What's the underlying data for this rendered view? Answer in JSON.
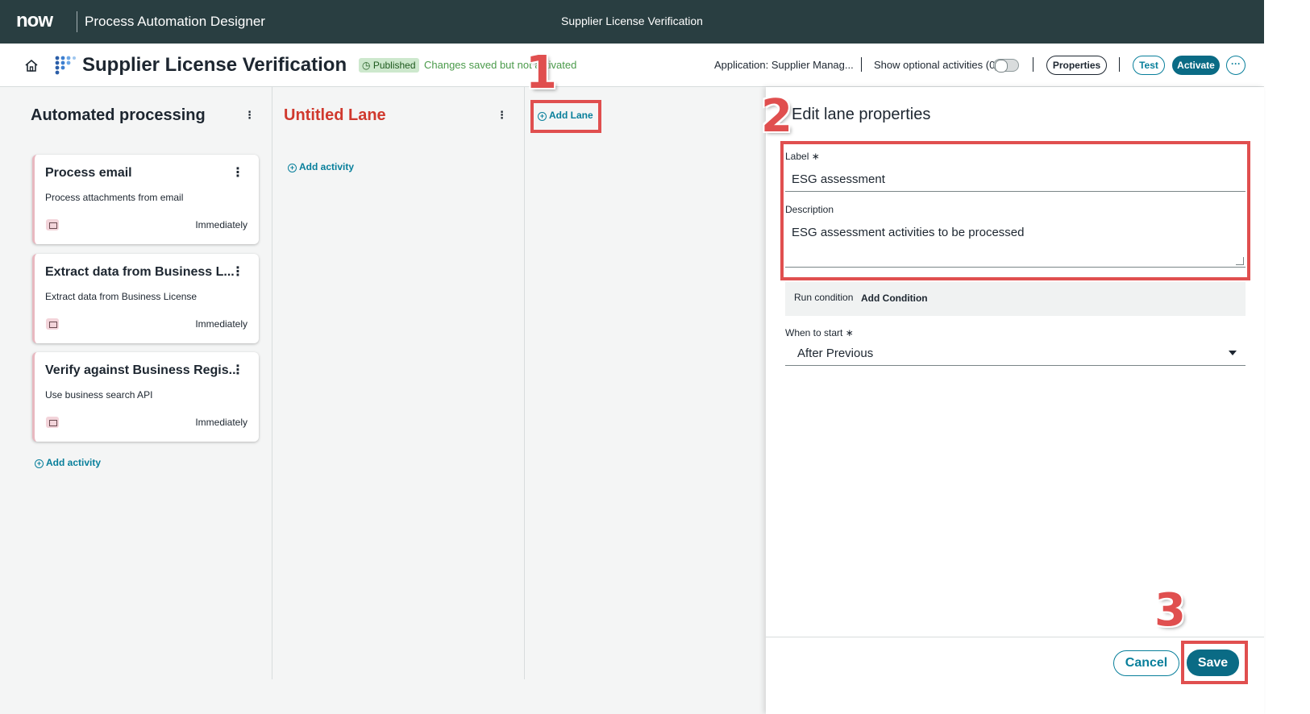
{
  "topbar": {
    "logo": "now",
    "app_name": "Process Automation Designer",
    "window_title": "Supplier License Verification"
  },
  "header": {
    "title": "Supplier License Verification",
    "status_badge": "Published",
    "status_note": "Changes saved but not activated",
    "application": "Application: Supplier Manag...",
    "optional_activities": "Show optional activities (0)",
    "properties_label": "Properties",
    "test_label": "Test",
    "activate_label": "Activate",
    "more_label": "···"
  },
  "lanes": [
    {
      "title": "Automated processing",
      "add_activity": "Add activity",
      "activities": [
        {
          "title": "Process email",
          "description": "Process attachments from email",
          "timing": "Immediately"
        },
        {
          "title": "Extract data from Business L...",
          "description": "Extract data from Business License",
          "timing": "Immediately"
        },
        {
          "title": "Verify against Business Regis...",
          "description": "Use business search API",
          "timing": "Immediately"
        }
      ]
    },
    {
      "title": "Untitled Lane",
      "add_activity": "Add activity"
    }
  ],
  "add_lane": "Add Lane",
  "panel": {
    "title": "Edit lane properties",
    "label_field": "Label",
    "label_value": "ESG assessment",
    "description_field": "Description",
    "description_value": "ESG assessment activities to be processed",
    "run_condition_label": "Run condition",
    "add_condition": "Add Condition",
    "when_to_start_field": "When to start",
    "when_to_start_value": "After Previous",
    "required_mark": "∗",
    "cancel_label": "Cancel",
    "save_label": "Save"
  },
  "annotations": [
    "1",
    "2",
    "3"
  ],
  "colors": {
    "topbar": "#293e41",
    "accent": "#0a6b85",
    "lane_title_red": "#d0392e",
    "highlight": "#e04f4f"
  }
}
